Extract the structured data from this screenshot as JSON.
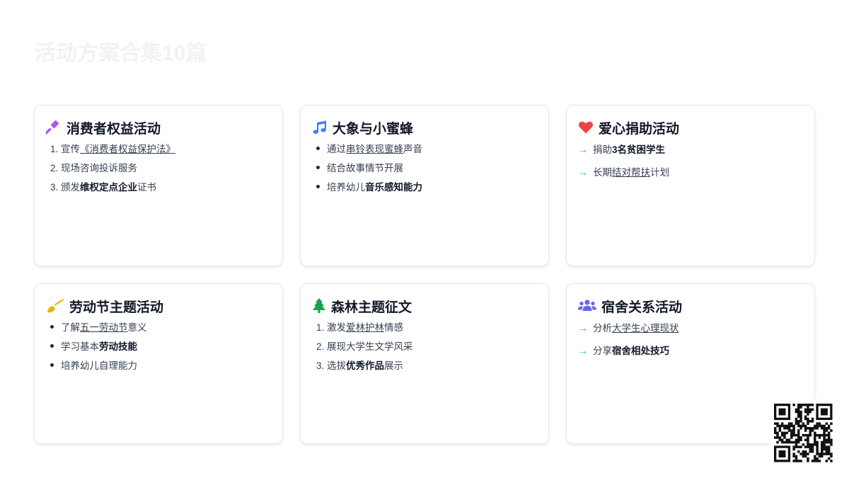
{
  "page": {
    "title": "活动方案合集10篇"
  },
  "colors": {
    "purple": "#a855f7",
    "blue": "#3b82f6",
    "red": "#ef4444",
    "yellow": "#eab308",
    "green": "#16a34a",
    "indigo": "#6366f1",
    "arrow": "#22c55e"
  },
  "cards": [
    {
      "title": "消费者权益活动",
      "icon": "gavel-icon",
      "list_type": "ordered",
      "items": [
        {
          "num": "1.",
          "parts": [
            "宣传",
            "《消费者权益保护法》",
            ""
          ]
        },
        {
          "num": "2.",
          "parts": [
            "现场咨询投诉服务",
            "",
            ""
          ]
        },
        {
          "num": "3.",
          "parts": [
            "颁发",
            "维权定点企业",
            "证书"
          ]
        }
      ]
    },
    {
      "title": "大象与小蜜蜂",
      "icon": "music-note-icon",
      "list_type": "bullet",
      "items": [
        {
          "parts": [
            "通过",
            "串铃表现蜜蜂",
            "声音"
          ]
        },
        {
          "parts": [
            "结合故事情节开展",
            "",
            ""
          ]
        },
        {
          "parts": [
            "培养幼儿",
            "音乐感知能力",
            ""
          ]
        }
      ]
    },
    {
      "title": "爱心捐助活动",
      "icon": "heart-icon",
      "list_type": "arrow",
      "items": [
        {
          "parts": [
            "捐助",
            "3名贫困学生",
            ""
          ]
        },
        {
          "parts": [
            "长期",
            "结对帮扶",
            "计划"
          ]
        }
      ]
    },
    {
      "title": "劳动节主题活动",
      "icon": "broom-icon",
      "list_type": "bullet",
      "items": [
        {
          "parts": [
            "了解",
            "五一劳动节",
            "意义"
          ]
        },
        {
          "parts": [
            "学习基本",
            "劳动技能",
            ""
          ]
        },
        {
          "parts": [
            "培养幼儿自理能力",
            "",
            ""
          ]
        }
      ]
    },
    {
      "title": "森林主题征文",
      "icon": "tree-icon",
      "list_type": "ordered",
      "items": [
        {
          "num": "1.",
          "parts": [
            "激发",
            "爱林护林",
            "情感"
          ]
        },
        {
          "num": "2.",
          "parts": [
            "展现大学生文学风采",
            "",
            ""
          ]
        },
        {
          "num": "3.",
          "parts": [
            "选拔",
            "优秀作品",
            "展示"
          ]
        }
      ]
    },
    {
      "title": "宿舍关系活动",
      "icon": "users-icon",
      "list_type": "arrow",
      "items": [
        {
          "parts": [
            "分析",
            "大学生心理现状",
            ""
          ]
        },
        {
          "parts": [
            "分享",
            "宿舍相处技巧",
            ""
          ]
        }
      ]
    }
  ]
}
